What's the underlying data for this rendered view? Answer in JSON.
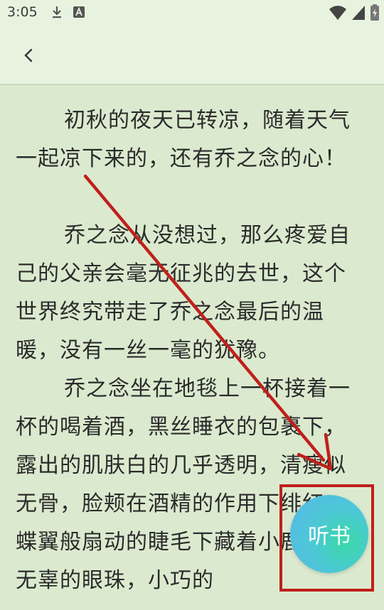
{
  "status_bar": {
    "time": "3:05",
    "icons": [
      "download-icon",
      "a-notification-icon",
      "wifi-icon",
      "signal-icon",
      "battery-charging-icon"
    ]
  },
  "header": {
    "back_icon": "chevron-left-icon"
  },
  "content": {
    "paragraphs": [
      "初秋的夜天已转凉，随着天气一起凉下来的，还有乔之念的心！",
      "乔之念从没想过，那么疼爱自己的父亲会毫无征兆的去世，这个世界终究带走了乔之念最后的温暖，没有一丝一毫的犹豫。",
      "乔之念坐在地毯上一杯接着一杯的喝着酒，黑丝睡衣的包裹下，露出的肌肤白的几乎透明，清瘦似无骨，脸颊在酒精的作用下绯红，蝶翼般扇动的睫毛下藏着小鹿一样无辜的眼珠，小巧的"
    ]
  },
  "listen_button": {
    "label": "听书"
  },
  "colors": {
    "background": "#dbeacf",
    "header": "#e8f3df",
    "annotation": "#c0201b"
  }
}
